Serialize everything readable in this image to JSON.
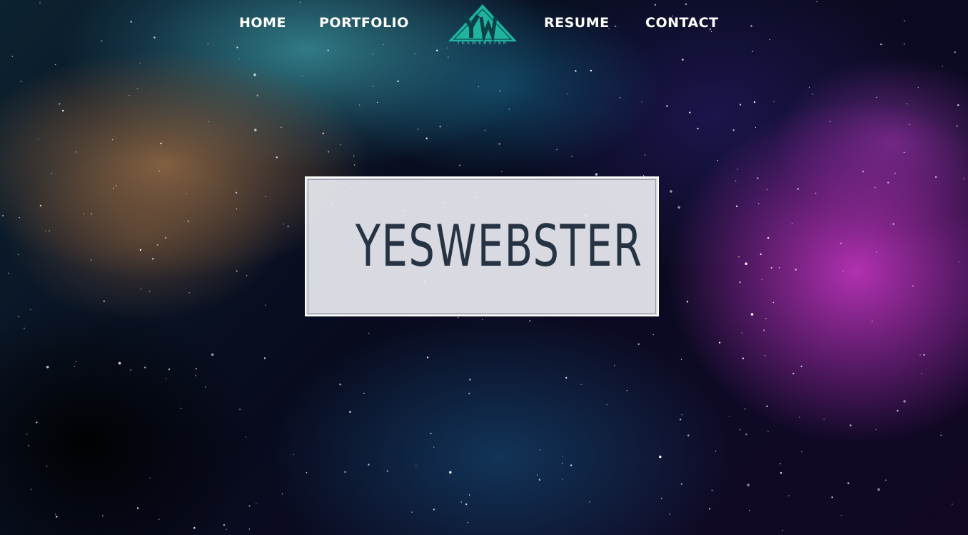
{
  "nav": {
    "links": [
      {
        "label": "HOME"
      },
      {
        "label": "PORTFOLIO"
      },
      {
        "label": "RESUME"
      },
      {
        "label": "CONTACT"
      }
    ],
    "logo": {
      "monogram": "YW",
      "wordmark": "YESWEBSTER",
      "color": "#20b3a0"
    }
  },
  "hero": {
    "title": "YESWEBSTER",
    "box_color": "#e8eaf0",
    "title_color": "#263343"
  }
}
